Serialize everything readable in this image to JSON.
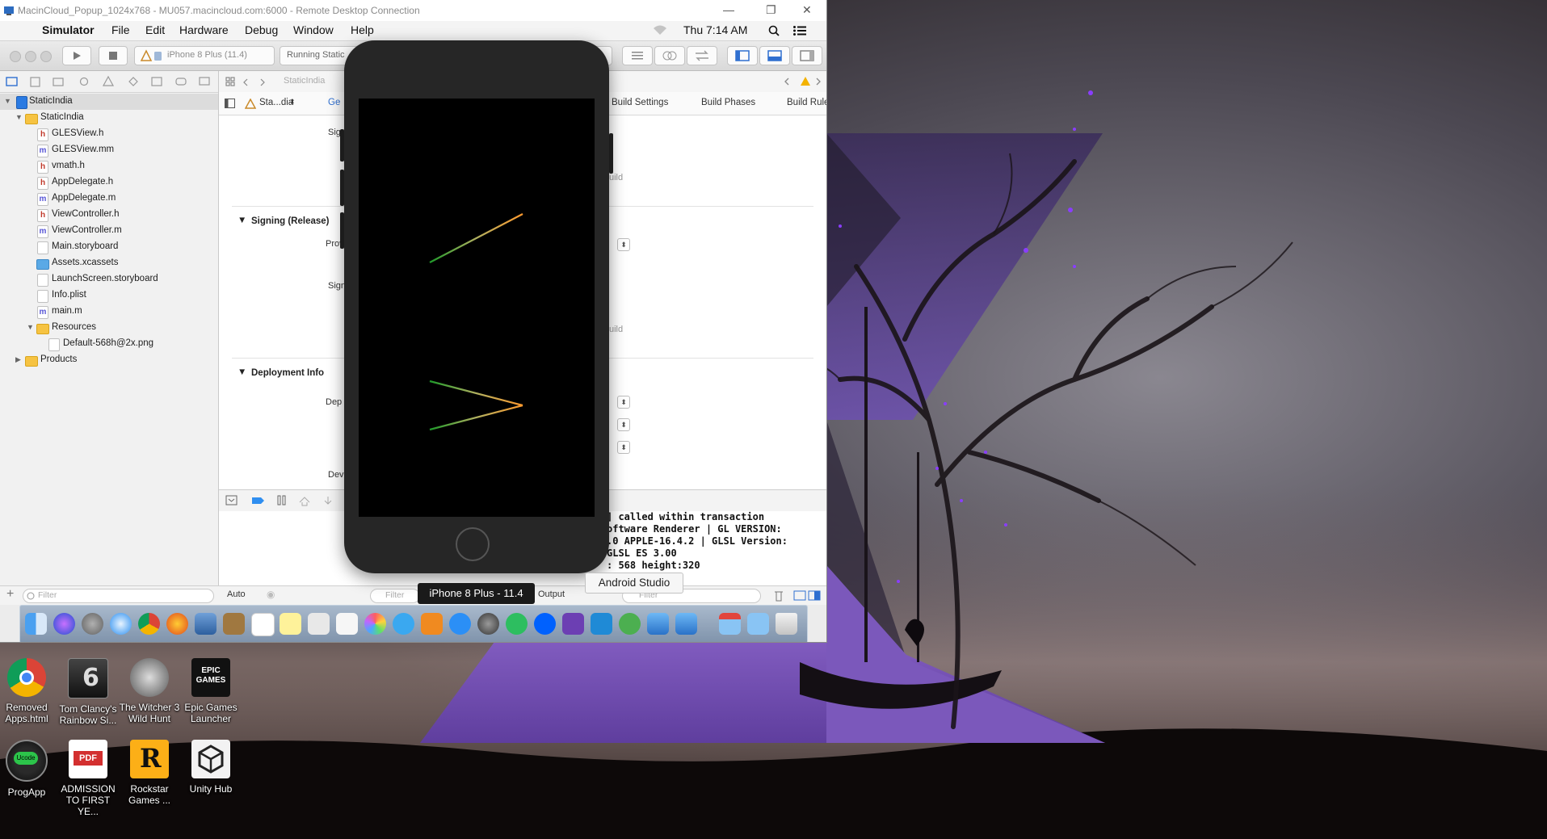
{
  "rdc": {
    "title": "MacinCloud_Popup_1024x768 - MU057.macincloud.com:6000 - Remote Desktop Connection",
    "minimize": "—",
    "restore": "❐",
    "close": "✕"
  },
  "menubar": {
    "app": "Simulator",
    "items": [
      "File",
      "Edit",
      "Hardware",
      "Debug",
      "Window",
      "Help"
    ],
    "clock": "Thu 7:14 AM"
  },
  "toolbar": {
    "scheme": "iPhone 8 Plus (11.4)",
    "status": "Running Static"
  },
  "navigator": {
    "items": [
      {
        "label": "StaticIndia",
        "kind": "proj"
      },
      {
        "label": "StaticIndia",
        "kind": "folder"
      },
      {
        "label": "GLESView.h",
        "kind": "h"
      },
      {
        "label": "GLESView.mm",
        "kind": "m"
      },
      {
        "label": "vmath.h",
        "kind": "h"
      },
      {
        "label": "AppDelegate.h",
        "kind": "h"
      },
      {
        "label": "AppDelegate.m",
        "kind": "m"
      },
      {
        "label": "ViewController.h",
        "kind": "h"
      },
      {
        "label": "ViewController.m",
        "kind": "m"
      },
      {
        "label": "Main.storyboard",
        "kind": "doc"
      },
      {
        "label": "Assets.xcassets",
        "kind": "asset"
      },
      {
        "label": "LaunchScreen.storyboard",
        "kind": "doc"
      },
      {
        "label": "Info.plist",
        "kind": "doc"
      },
      {
        "label": "main.m",
        "kind": "m"
      },
      {
        "label": "Resources",
        "kind": "folder"
      },
      {
        "label": "Default-568h@2x.png",
        "kind": "doc"
      },
      {
        "label": "Products",
        "kind": "folder"
      }
    ],
    "filter_placeholder": "Filter"
  },
  "editor": {
    "jump_file": "StaticIndia",
    "target": "Sta...dia",
    "tab_general": "Ge",
    "tabs": [
      "Build Settings",
      "Build Phases",
      "Build Rule"
    ],
    "sections": {
      "signing_release": "Signing (Release)",
      "deployment": "Deployment Info"
    },
    "labels": {
      "sig1": "Sig",
      "prov": "Prov",
      "sig2": "Sign",
      "dep": "Dep",
      "dev": "Dev",
      "build1": "uild",
      "build2": "uild"
    }
  },
  "console": {
    "lines": [
      "] called within transaction",
      "oftware Renderer | GL VERSION:",
      ".0 APPLE-16.4.2 | GLSL Version:",
      "GLSL ES 3.00",
      ": 568 height:320"
    ]
  },
  "bottom": {
    "auto": "Auto",
    "filter": "Filter",
    "output": "Output",
    "filter2": "Filter"
  },
  "simulator": {
    "device_label": "iPhone 8 Plus - 11.4",
    "tooltip": "Android Studio"
  },
  "desktop_icons": [
    {
      "label": "Removed Apps.html",
      "icon": "chrome-icon"
    },
    {
      "label": "Tom Clancy's Rainbow Si...",
      "icon": "rainbow-six-icon"
    },
    {
      "label": "The Witcher 3 Wild Hunt",
      "icon": "witcher-icon"
    },
    {
      "label": "Epic Games Launcher",
      "icon": "epic-games-icon"
    },
    {
      "label": "ProgApp",
      "icon": "progapp-icon"
    },
    {
      "label": "ADMISSION TO FIRST YE...",
      "icon": "pdf-icon"
    },
    {
      "label": "Rockstar Games ...",
      "icon": "rockstar-icon"
    },
    {
      "label": "Unity Hub",
      "icon": "unity-icon"
    }
  ],
  "epic_logo_text": "EPIC GAMES",
  "pdf_text": "PDF",
  "progapp_text": "Ucode"
}
